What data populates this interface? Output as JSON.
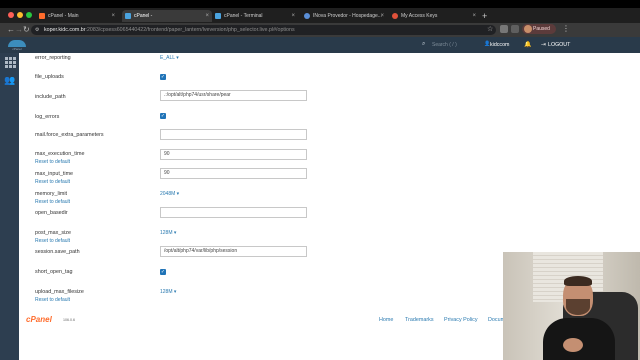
{
  "browser": {
    "tabs": [
      {
        "title": "cPanel - Main",
        "active": false
      },
      {
        "title": "cPanel -",
        "active": true
      },
      {
        "title": "cPanel - Terminal",
        "active": false
      },
      {
        "title": "INova Provedor - Hospedage...",
        "active": false
      },
      {
        "title": "My Access Keys",
        "active": false
      }
    ],
    "new_tab": "+",
    "url_host": "koper.kidc.com.br",
    "url_rest": ":2083/cpsess6065440422/frontend/paper_lantern/lveversion/php_selector.live.pl#/options",
    "profile_label": "Paused",
    "colors": {
      "tabbar": "#1f1f1f",
      "toolbar": "#3a3a3a"
    }
  },
  "cpanel": {
    "logo_text": "cPanel",
    "search_placeholder": "Search ( / )",
    "user_name": "kidccom",
    "logout_label": "LOGOUT",
    "reset_label": "Reset to default",
    "options": {
      "error_reporting": {
        "label": "error_reporting",
        "value": "E_ALL"
      },
      "file_uploads": {
        "label": "file_uploads",
        "checked": true
      },
      "include_path": {
        "label": "include_path",
        "value": ".:/opt/alt/php74/usr/share/pear"
      },
      "log_errors": {
        "label": "log_errors",
        "checked": true
      },
      "mail_force_extra_parameters": {
        "label": "mail.force_extra_parameters",
        "value": ""
      },
      "max_execution_time": {
        "label": "max_execution_time",
        "value": "90"
      },
      "max_input_time": {
        "label": "max_input_time",
        "value": "90"
      },
      "memory_limit": {
        "label": "memory_limit",
        "value": "2048M"
      },
      "open_basedir": {
        "label": "open_basedir",
        "value": ""
      },
      "post_max_size": {
        "label": "post_max_size",
        "value": "128M"
      },
      "session_save_path": {
        "label": "session.save_path",
        "value": "/opt/alt/php74/var/lib/php/session"
      },
      "short_open_tag": {
        "label": "short_open_tag",
        "checked": true
      },
      "upload_max_filesize": {
        "label": "upload_max_filesize",
        "value": "128M"
      }
    },
    "footer": {
      "logo": "cPanel",
      "version": "106.0.6",
      "links": [
        "Home",
        "Trademarks",
        "Privacy Policy",
        "Documentation"
      ]
    },
    "colors": {
      "topnav": "#293a4a",
      "sidebar": "#2d3e50",
      "link": "#2a7ab0",
      "checkbox": "#1f73b7"
    }
  }
}
